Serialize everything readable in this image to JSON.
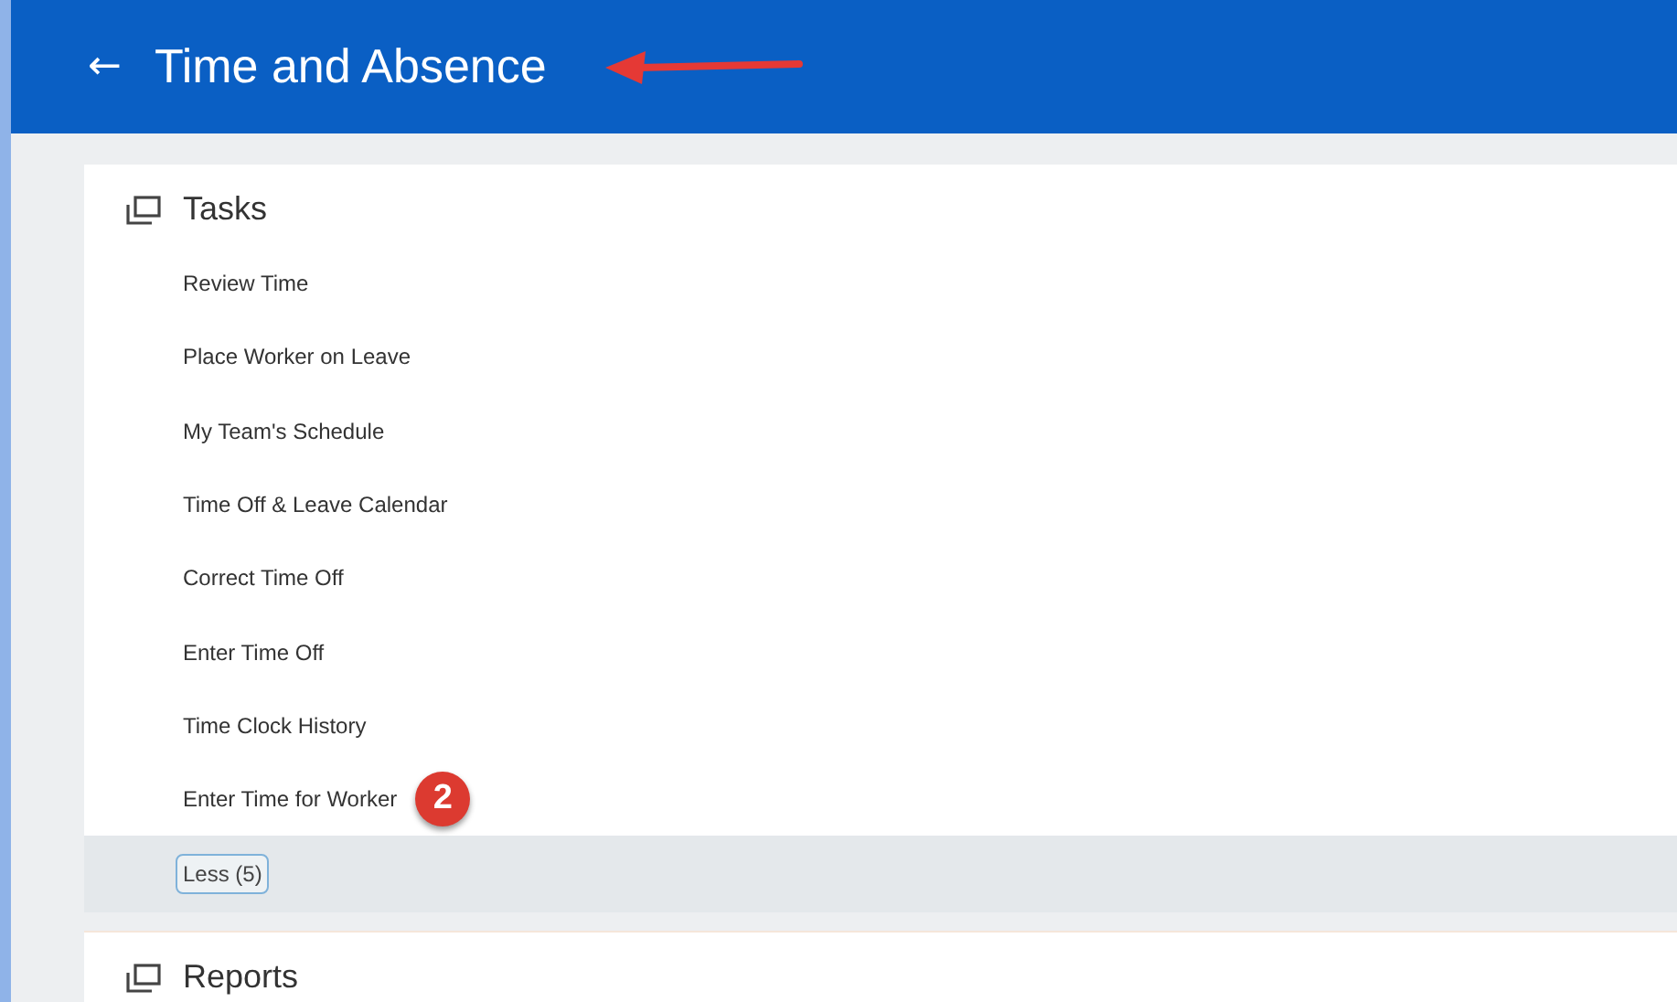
{
  "header": {
    "back": "←",
    "title": "Time and Absence"
  },
  "tasks": {
    "title": "Tasks",
    "items": [
      {
        "label": "Review Time"
      },
      {
        "label": "Place Worker on Leave"
      },
      {
        "label": "My Team's Schedule"
      },
      {
        "label": "Time Off & Leave Calendar"
      },
      {
        "label": "Correct Time Off"
      },
      {
        "label": "Enter Time Off"
      },
      {
        "label": "Time Clock History"
      },
      {
        "label": "Enter Time for Worker",
        "callout": "2"
      }
    ],
    "less": "Less (5)"
  },
  "reports": {
    "title": "Reports"
  }
}
